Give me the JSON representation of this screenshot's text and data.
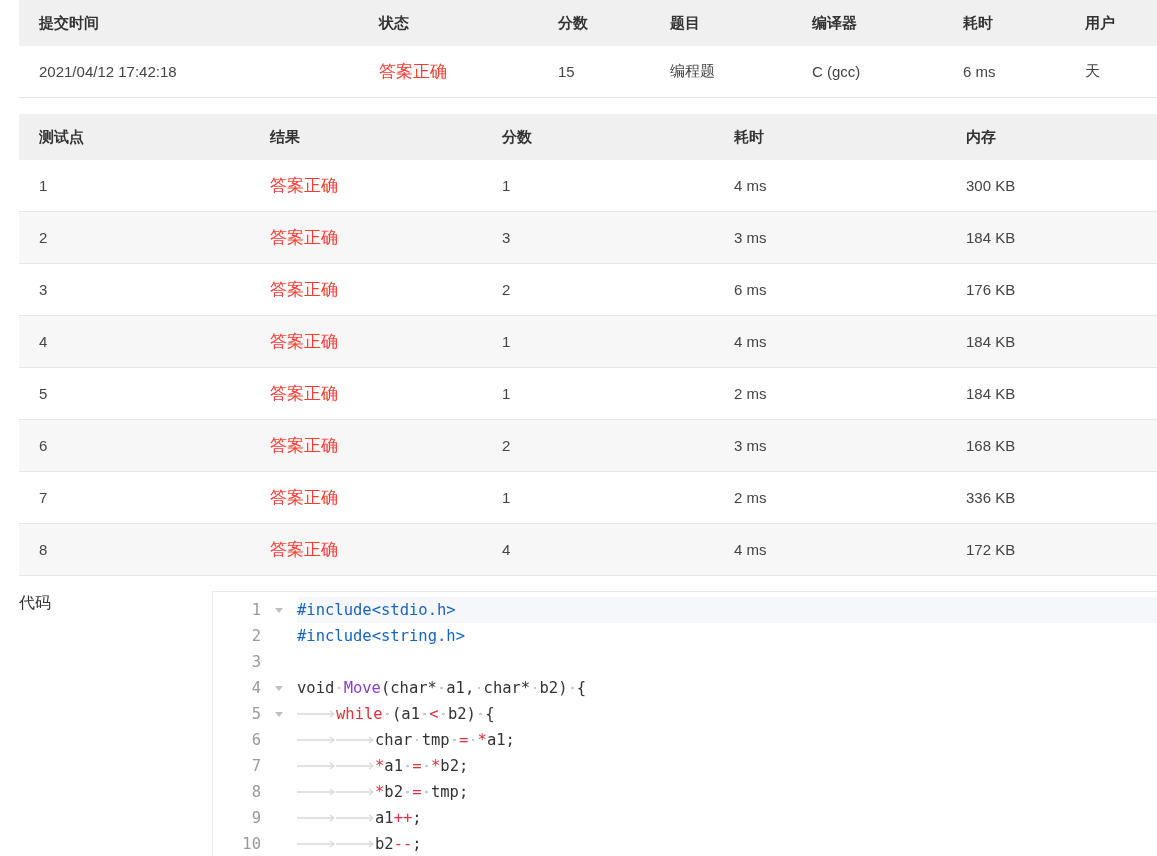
{
  "submission": {
    "columns": [
      "提交时间",
      "状态",
      "分数",
      "题目",
      "编译器",
      "耗时",
      "用户"
    ],
    "row": [
      {
        "text": "2021/04/12 17:42:18",
        "kind": "plain"
      },
      {
        "text": "答案正确",
        "kind": "status"
      },
      {
        "text": "15",
        "kind": "plain"
      },
      {
        "text": "编程题",
        "kind": "plain"
      },
      {
        "text": "C (gcc)",
        "kind": "plain"
      },
      {
        "text": "6 ms",
        "kind": "plain"
      },
      {
        "text": "天",
        "kind": "plain"
      }
    ]
  },
  "tests": {
    "columns": [
      "测试点",
      "结果",
      "分数",
      "耗时",
      "内存"
    ],
    "rows": [
      [
        "1",
        "答案正确",
        "1",
        "4 ms",
        "300 KB"
      ],
      [
        "2",
        "答案正确",
        "3",
        "3 ms",
        "184 KB"
      ],
      [
        "3",
        "答案正确",
        "2",
        "6 ms",
        "176 KB"
      ],
      [
        "4",
        "答案正确",
        "1",
        "4 ms",
        "184 KB"
      ],
      [
        "5",
        "答案正确",
        "1",
        "2 ms",
        "184 KB"
      ],
      [
        "6",
        "答案正确",
        "2",
        "3 ms",
        "168 KB"
      ],
      [
        "7",
        "答案正确",
        "1",
        "2 ms",
        "336 KB"
      ],
      [
        "8",
        "答案正确",
        "4",
        "4 ms",
        "172 KB"
      ]
    ]
  },
  "code": {
    "label": "代码",
    "lines": [
      {
        "number": "1",
        "fold": true,
        "active": true,
        "tokens": [
          {
            "text": "#include<stdio.h>",
            "kind": "pre"
          }
        ]
      },
      {
        "number": "2",
        "fold": false,
        "active": false,
        "tokens": [
          {
            "text": "#include<string.h>",
            "kind": "pre"
          }
        ]
      },
      {
        "number": "3",
        "fold": false,
        "active": false
      },
      {
        "number": "4",
        "fold": true,
        "active": false,
        "tokens": [
          {
            "text": "void ",
            "kind": "plain"
          },
          {
            "text": "Move",
            "kind": "fn"
          },
          {
            "text": "(char* a1, char* b2) {",
            "kind": "plain"
          }
        ]
      },
      {
        "number": "5",
        "fold": true,
        "active": false,
        "tokens": [
          {
            "text": "\twhile",
            "kind": "kw"
          },
          {
            "text": " (a1 ",
            "kind": "plain"
          },
          {
            "text": "<",
            "kind": "op"
          },
          {
            "text": " b2) {",
            "kind": "plain"
          }
        ]
      },
      {
        "number": "6",
        "fold": false,
        "active": false,
        "tokens": [
          {
            "text": "\t\tchar tmp ",
            "kind": "plain"
          },
          {
            "text": "= *",
            "kind": "op"
          },
          {
            "text": "a1;",
            "kind": "plain"
          }
        ]
      },
      {
        "number": "7",
        "fold": false,
        "active": false,
        "tokens": [
          {
            "text": "\t\t*",
            "kind": "op"
          },
          {
            "text": "a1 ",
            "kind": "plain"
          },
          {
            "text": "=",
            "kind": "op"
          },
          {
            "text": " *",
            "kind": "op"
          },
          {
            "text": "b2;",
            "kind": "plain"
          }
        ]
      },
      {
        "number": "8",
        "fold": false,
        "active": false,
        "tokens": [
          {
            "text": "\t\t*",
            "kind": "op"
          },
          {
            "text": "b2 ",
            "kind": "plain"
          },
          {
            "text": "=",
            "kind": "op"
          },
          {
            "text": " tmp;",
            "kind": "plain"
          }
        ]
      },
      {
        "number": "9",
        "fold": false,
        "active": false,
        "tokens": [
          {
            "text": "\t\ta1",
            "kind": "plain"
          },
          {
            "text": "++",
            "kind": "op"
          },
          {
            "text": ";",
            "kind": "plain"
          }
        ]
      },
      {
        "number": "10",
        "fold": false,
        "active": false,
        "tokens": [
          {
            "text": "\t\tb2",
            "kind": "plain"
          },
          {
            "text": "--",
            "kind": "op"
          },
          {
            "text": ";",
            "kind": "plain"
          }
        ]
      }
    ]
  }
}
